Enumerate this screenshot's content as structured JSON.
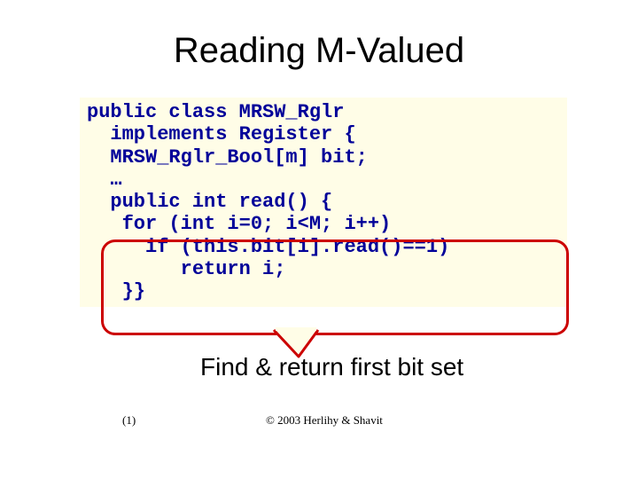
{
  "title": "Reading M-Valued",
  "code": {
    "l1": "public class MRSW_Rglr ",
    "l2": "  implements Register {",
    "l3": "  MRSW_Rglr_Bool[m] bit;",
    "l4": "  …",
    "l5": "  public int read() {",
    "l6": "   for (int i=0; i<M; i++)",
    "l7": "     if (this.bit[i].read()==1) ",
    "l8": "        return i;",
    "l9": "   }}"
  },
  "annotation": "Find & return first bit set",
  "footer_left": "(1)",
  "footer_center": "© 2003 Herlihy & Shavit"
}
